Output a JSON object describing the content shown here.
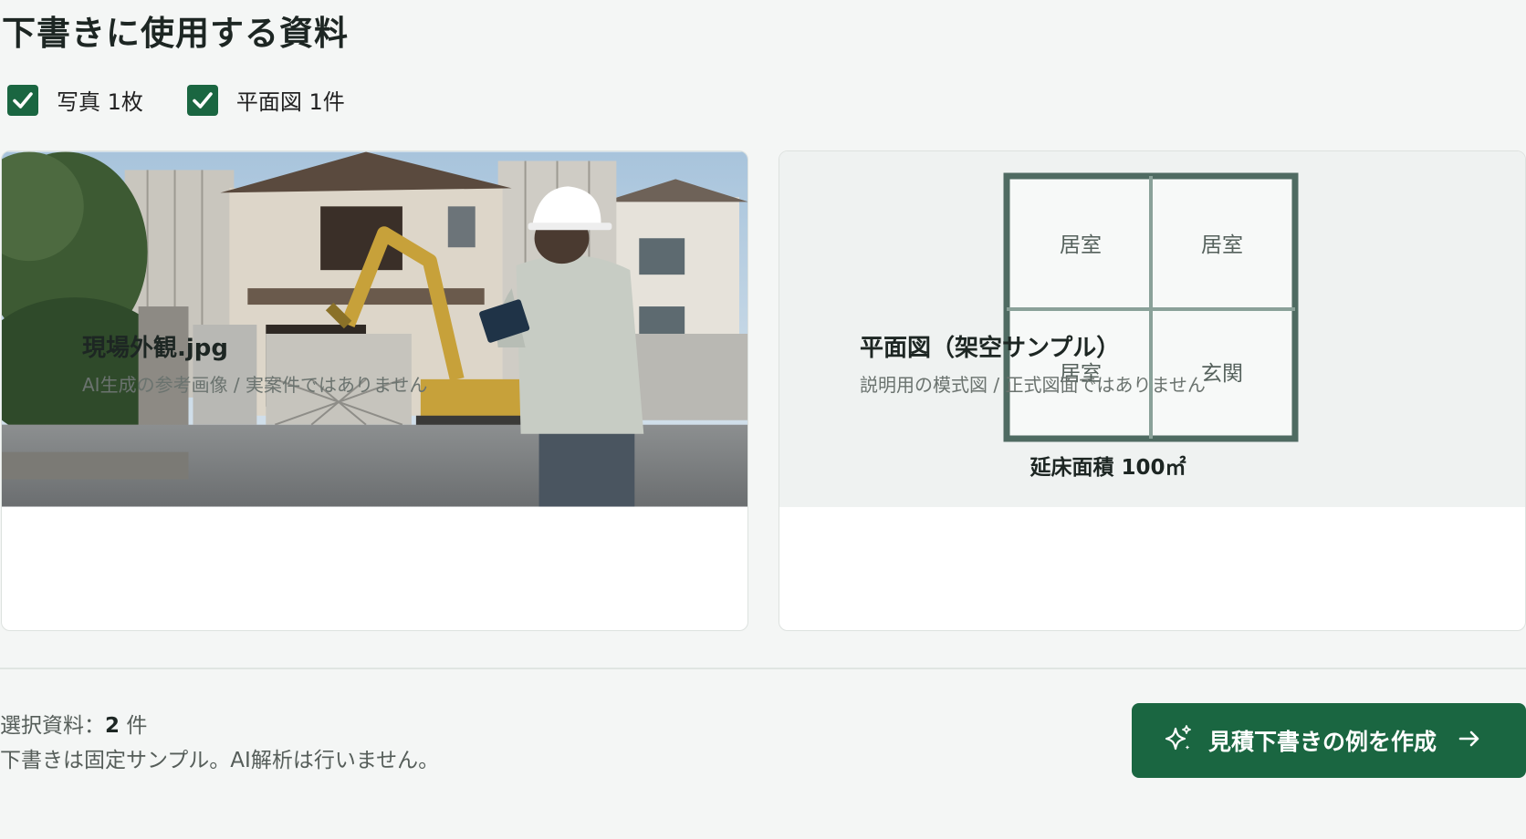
{
  "page": {
    "title": "下書きに使用する資料"
  },
  "filters": [
    {
      "label": "写真 1枚",
      "checked": true
    },
    {
      "label": "平面図 1件",
      "checked": true
    }
  ],
  "cards": {
    "photo": {
      "name": "現場外観.jpg",
      "note": "AI生成の参考画像 / 実案件ではありません"
    },
    "plan": {
      "rooms": [
        "居室",
        "居室",
        "居室",
        "玄関"
      ],
      "area_label": "延床面積 100㎡",
      "name": "平面図（架空サンプル）",
      "note": "説明用の模式図 / 正式図面ではありません"
    }
  },
  "footer": {
    "selected_prefix": "選択資料：",
    "selected_count": "2",
    "selected_suffix": " 件",
    "note": "下書きは固定サンプル。AI解析は行いません。",
    "cta_label": "見積下書きの例を作成"
  },
  "icons": {
    "check": "check-icon",
    "image": "image-icon",
    "document": "document-icon",
    "sparkle": "sparkle-icon",
    "arrow": "arrow-right-icon"
  },
  "colors": {
    "accent": "#1a6641",
    "plan_wall": "#4f6b62"
  }
}
